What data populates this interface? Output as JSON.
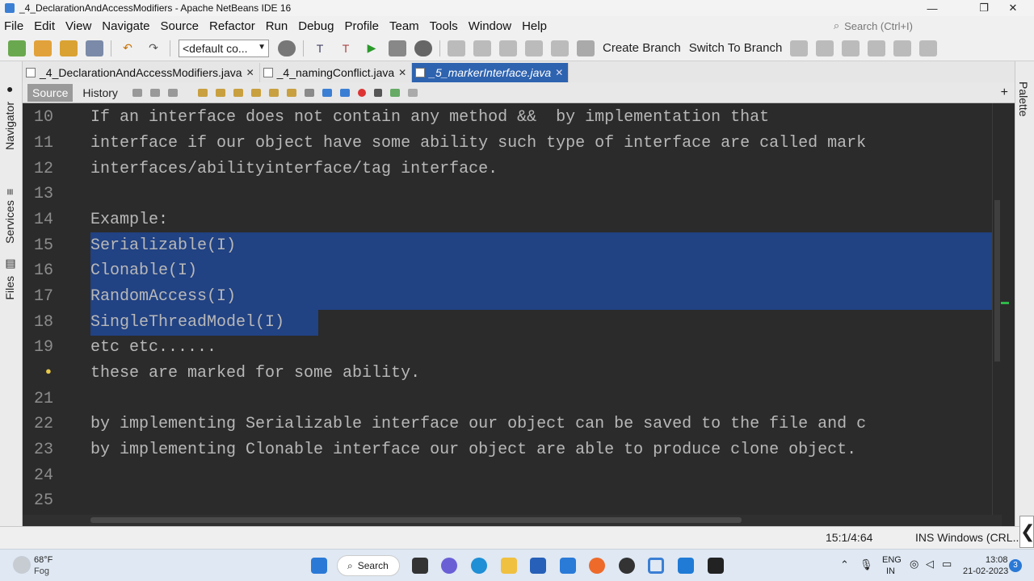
{
  "window": {
    "title": "_4_DeclarationAndAccessModifiers - Apache NetBeans IDE 16",
    "controls": [
      "—",
      "❐",
      "✕"
    ]
  },
  "menu": [
    "File",
    "Edit",
    "View",
    "Navigate",
    "Source",
    "Refactor",
    "Run",
    "Debug",
    "Profile",
    "Team",
    "Tools",
    "Window",
    "Help"
  ],
  "search": {
    "placeholder": "Search (Ctrl+I)"
  },
  "toolbar": {
    "config": "<default co...",
    "create_branch": "Create Branch",
    "switch_branch": "Switch To Branch"
  },
  "left_panels": [
    "Navigator",
    "Services",
    "Files"
  ],
  "right_panels": [
    "Palette"
  ],
  "tabs": [
    {
      "label": "_4_DeclarationAndAccessModifiers.java",
      "active": false
    },
    {
      "label": "_4_namingConflict.java",
      "active": false
    },
    {
      "label": "_5_markerInterface.java",
      "active": true
    }
  ],
  "editor_tabs": {
    "source": "Source",
    "history": "History"
  },
  "code_lines": [
    {
      "n": "10",
      "text": "If an interface does not contain any method &&  by implementation that"
    },
    {
      "n": "11",
      "text": "interface if our object have some ability such type of interface are called mark"
    },
    {
      "n": "12",
      "text": "interfaces/abilityinterface/tag interface."
    },
    {
      "n": "13",
      "text": ""
    },
    {
      "n": "14",
      "text": "Example:"
    },
    {
      "n": "15",
      "text": "Serializable(I)"
    },
    {
      "n": "16",
      "text": "Clonable(I)"
    },
    {
      "n": "17",
      "text": "RandomAccess(I)"
    },
    {
      "n": "18",
      "text": "SingleThreadModel(I)"
    },
    {
      "n": "19",
      "text": "etc etc......"
    },
    {
      "n": "",
      "text": "these are marked for some ability."
    },
    {
      "n": "21",
      "text": ""
    },
    {
      "n": "22",
      "text": "by implementing Serializable interface our object can be saved to the file and c"
    },
    {
      "n": "23",
      "text": "by implementing Clonable interface our object are able to produce clone object."
    },
    {
      "n": "24",
      "text": ""
    },
    {
      "n": "25",
      "text": ""
    }
  ],
  "status": {
    "position": "15:1/4:64",
    "mode": "INS Windows (CRL..."
  },
  "taskbar": {
    "weather_temp": "68°F",
    "weather_desc": "Fog",
    "search_label": "Search",
    "lang_top": "ENG",
    "lang_bottom": "IN",
    "time": "13:08",
    "date": "21-02-2023",
    "notif_count": "3"
  }
}
